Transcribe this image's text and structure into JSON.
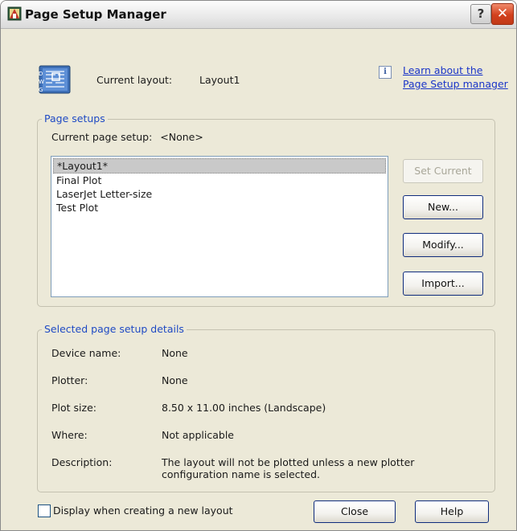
{
  "window": {
    "title": "Page Setup Manager",
    "help_glyph": "?",
    "close_glyph": "✕"
  },
  "layout": {
    "label": "Current layout:",
    "value": "Layout1"
  },
  "learn": {
    "info_glyph": "i",
    "line1": "Learn about the",
    "line2": "Page Setup manager"
  },
  "page_setups": {
    "title": "Page setups",
    "current_label": "Current page setup:",
    "current_value": "<None>",
    "items": [
      "*Layout1*",
      "Final Plot",
      "LaserJet Letter-size",
      "Test Plot"
    ],
    "selected_index": 0,
    "buttons": {
      "set_current": "Set Current",
      "new": "New...",
      "modify": "Modify...",
      "import": "Import..."
    }
  },
  "details": {
    "title": "Selected page setup details",
    "device_label": "Device name:",
    "device_value": "None",
    "plotter_label": "Plotter:",
    "plotter_value": "None",
    "size_label": "Plot size:",
    "size_value": "8.50 x 11.00 inches (Landscape)",
    "where_label": "Where:",
    "where_value": "Not applicable",
    "description_label": "Description:",
    "description_line1": "The layout will not be plotted unless a new plotter",
    "description_line2": "configuration name is selected."
  },
  "footer": {
    "checkbox_label": "Display when creating a new layout",
    "checkbox_checked": false,
    "close": "Close",
    "help": "Help"
  },
  "icons": {
    "title": "autocad-app-icon",
    "layout": "page-setup-icon",
    "info": "info-icon",
    "help": "question-icon",
    "close": "close-icon"
  },
  "colors": {
    "link": "#1a35c8",
    "group_title": "#1f4ac4",
    "dialog_bg": "#ece9d8",
    "close_button": "#d2401d"
  }
}
